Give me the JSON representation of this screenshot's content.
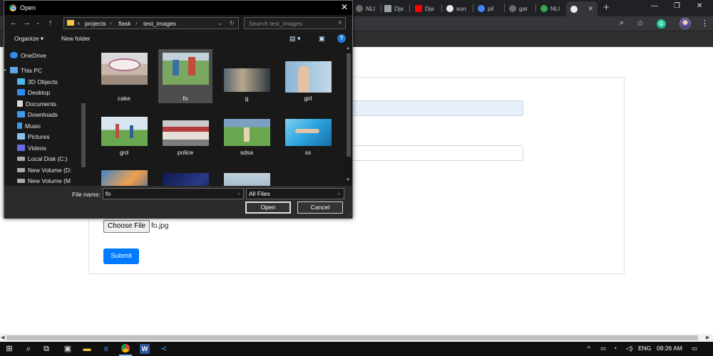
{
  "browser": {
    "tabs": [
      {
        "label": "NLI",
        "favicon_color": "#6b6b6b"
      },
      {
        "label": "Dja",
        "favicon_color": "#9aa0a6"
      },
      {
        "label": "Dja",
        "favicon_color": "#ff0000"
      },
      {
        "label": "sun",
        "favicon_color": "#e8eaed"
      },
      {
        "label": "pil",
        "favicon_color": "#4285f4"
      },
      {
        "label": "gal",
        "favicon_color": "#6b6b6b"
      },
      {
        "label": "NLI",
        "favicon_color": "#34a853"
      },
      {
        "label": "",
        "favicon_color": "#e8eaed"
      }
    ],
    "new_tab_icon": "plus-icon",
    "grammarly_letter": "G"
  },
  "dialog": {
    "title": "Open",
    "breadcrumb": {
      "overflow": "«",
      "parts": [
        "projects",
        "flask",
        "test_images"
      ]
    },
    "search_placeholder": "Search test_images",
    "toolbar": {
      "organize_label": "Organize ▾",
      "new_folder_label": "New folder",
      "help_label": "?"
    },
    "nav_items": [
      {
        "label": "OneDrive",
        "icon_color": "#2f8df0"
      },
      {
        "label": "This PC",
        "icon_color": "#5aa6e6"
      },
      {
        "label": "3D Objects",
        "icon_color": "#4fb7e8"
      },
      {
        "label": "Desktop",
        "icon_color": "#2f8df0"
      },
      {
        "label": "Documents",
        "icon_color": "#d8d8d8"
      },
      {
        "label": "Downloads",
        "icon_color": "#3f9be8"
      },
      {
        "label": "Music",
        "icon_color": "#3f9be8"
      },
      {
        "label": "Pictures",
        "icon_color": "#8ec2ee"
      },
      {
        "label": "Videos",
        "icon_color": "#6a6ae0"
      },
      {
        "label": "Local Disk (C:)",
        "icon_color": "#a9a9a9"
      },
      {
        "label": "New Volume (D:",
        "icon_color": "#a9a9a9"
      },
      {
        "label": "New Volume (M",
        "icon_color": "#a9a9a9"
      }
    ],
    "files": [
      {
        "name": "cake",
        "colors": [
          "#d9d9d9",
          "#c9b8a8",
          "#b06a8e"
        ]
      },
      {
        "name": "fo",
        "colors": [
          "#7aa860",
          "#c44a3c",
          "#3c6ea8"
        ],
        "selected": true
      },
      {
        "name": "g",
        "colors": [
          "#b7a88c",
          "#5b6470",
          "#2f3a44"
        ]
      },
      {
        "name": "girl",
        "colors": [
          "#8bb5d6",
          "#e0c3a8",
          "#c2d8e8"
        ]
      },
      {
        "name": "grd",
        "colors": [
          "#d8e6f2",
          "#6aa84f",
          "#c24a4a"
        ]
      },
      {
        "name": "police",
        "colors": [
          "#c9c9c9",
          "#b53a3a",
          "#7d7d7d"
        ]
      },
      {
        "name": "sdsa",
        "colors": [
          "#6aa84f",
          "#7aa0c4",
          "#e8d3b0"
        ]
      },
      {
        "name": "ss",
        "colors": [
          "#2aa4e0",
          "#7fd0f0",
          "#1a6fa8"
        ]
      },
      {
        "name": "",
        "colors": [
          "#3f86c9",
          "#f0a050",
          "#2f5f99"
        ]
      },
      {
        "name": "",
        "colors": [
          "#0d1a4a",
          "#2a3a8a",
          "#111"
        ]
      },
      {
        "name": "",
        "colors": [
          "#9fb9c9",
          "#7a9a7a",
          "#c2d2dc"
        ]
      }
    ],
    "filename_label": "File name:",
    "filename_value": "fo",
    "filetype_value": "All Files",
    "open_label": "Open",
    "cancel_label": "Cancel"
  },
  "form": {
    "choose_file_label": "Choose File",
    "chosen_file_name": "fo.jpg",
    "submit_label": "Submit"
  },
  "taskbar": {
    "language": "ENG",
    "time": "09:26 AM"
  }
}
